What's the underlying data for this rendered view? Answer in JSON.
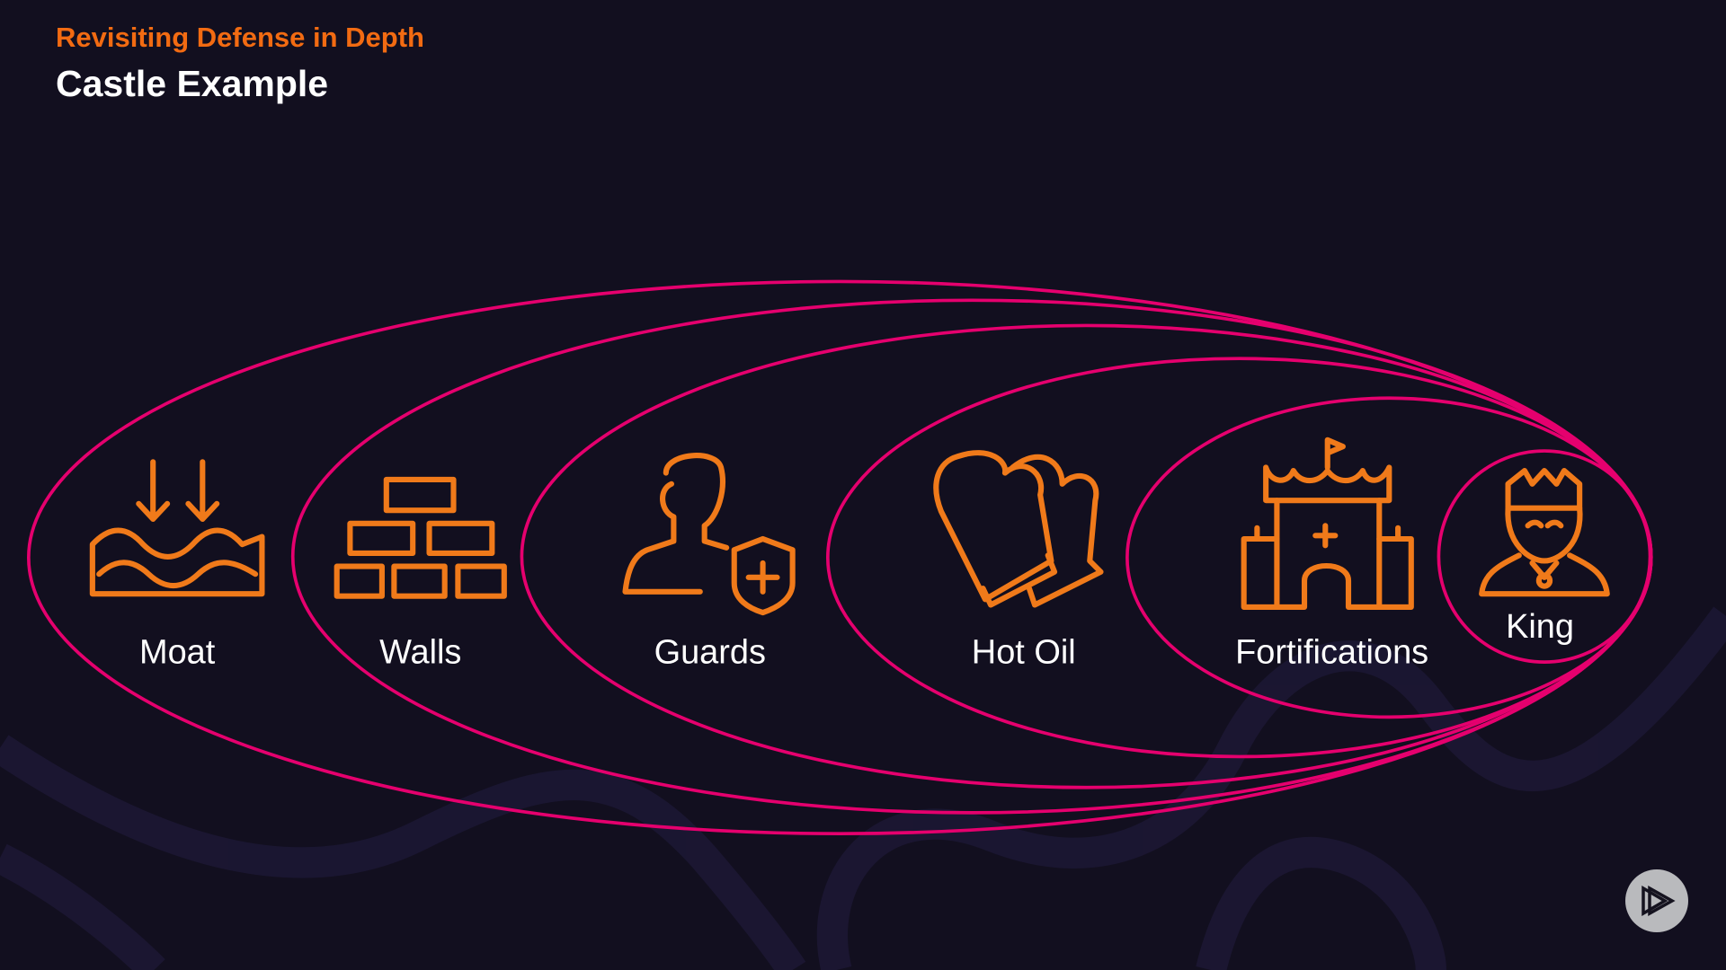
{
  "header": {
    "kicker": "Revisiting Defense in Depth",
    "title": "Castle Example"
  },
  "layers": [
    {
      "label": "Moat",
      "icon": "waves-arrows-icon"
    },
    {
      "label": "Walls",
      "icon": "bricks-icon"
    },
    {
      "label": "Guards",
      "icon": "guard-shield-icon"
    },
    {
      "label": "Hot Oil",
      "icon": "oven-mitts-icon"
    },
    {
      "label": "Fortifications",
      "icon": "castle-icon"
    },
    {
      "label": "King",
      "icon": "crown-king-icon"
    }
  ],
  "colors": {
    "background": "#120f1f",
    "accent": "#f26b12",
    "ring": "#e5006e",
    "text": "#ffffff"
  },
  "player": {
    "icon": "play-logo-icon"
  }
}
